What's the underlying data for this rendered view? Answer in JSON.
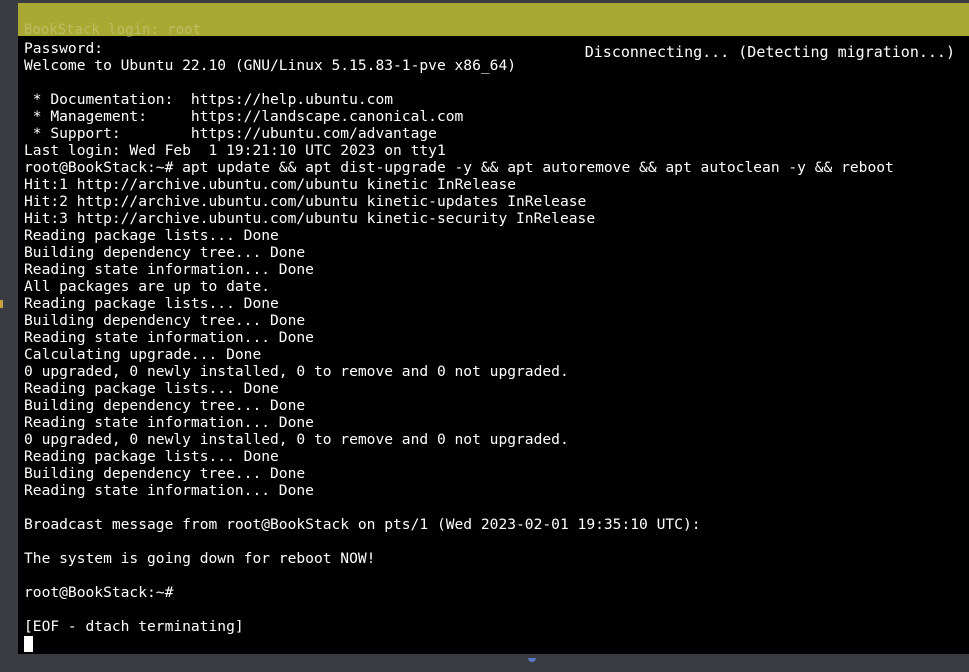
{
  "status_bar": {
    "text": "Disconnecting... (Detecting migration...)"
  },
  "ghost_line": "BookStack login: root",
  "terminal_lines": [
    "Password:",
    "Welcome to Ubuntu 22.10 (GNU/Linux 5.15.83-1-pve x86_64)",
    "",
    " * Documentation:  https://help.ubuntu.com",
    " * Management:     https://landscape.canonical.com",
    " * Support:        https://ubuntu.com/advantage",
    "Last login: Wed Feb  1 19:21:10 UTC 2023 on tty1",
    "root@BookStack:~# apt update && apt dist-upgrade -y && apt autoremove && apt autoclean -y && reboot",
    "Hit:1 http://archive.ubuntu.com/ubuntu kinetic InRelease",
    "Hit:2 http://archive.ubuntu.com/ubuntu kinetic-updates InRelease",
    "Hit:3 http://archive.ubuntu.com/ubuntu kinetic-security InRelease",
    "Reading package lists... Done",
    "Building dependency tree... Done",
    "Reading state information... Done",
    "All packages are up to date.",
    "Reading package lists... Done",
    "Building dependency tree... Done",
    "Reading state information... Done",
    "Calculating upgrade... Done",
    "0 upgraded, 0 newly installed, 0 to remove and 0 not upgraded.",
    "Reading package lists... Done",
    "Building dependency tree... Done",
    "Reading state information... Done",
    "0 upgraded, 0 newly installed, 0 to remove and 0 not upgraded.",
    "Reading package lists... Done",
    "Building dependency tree... Done",
    "Reading state information... Done",
    "",
    "Broadcast message from root@BookStack on pts/1 (Wed 2023-02-01 19:35:10 UTC):",
    "",
    "The system is going down for reboot NOW!",
    "",
    "root@BookStack:~#",
    "",
    "[EOF - dtach terminating]"
  ],
  "colors": {
    "status_bar_bg": "#a8a832",
    "terminal_bg": "#000000",
    "terminal_fg": "#ffffff",
    "frame_bg": "#3a3c42"
  },
  "icons": {
    "cursor": "block-cursor"
  }
}
